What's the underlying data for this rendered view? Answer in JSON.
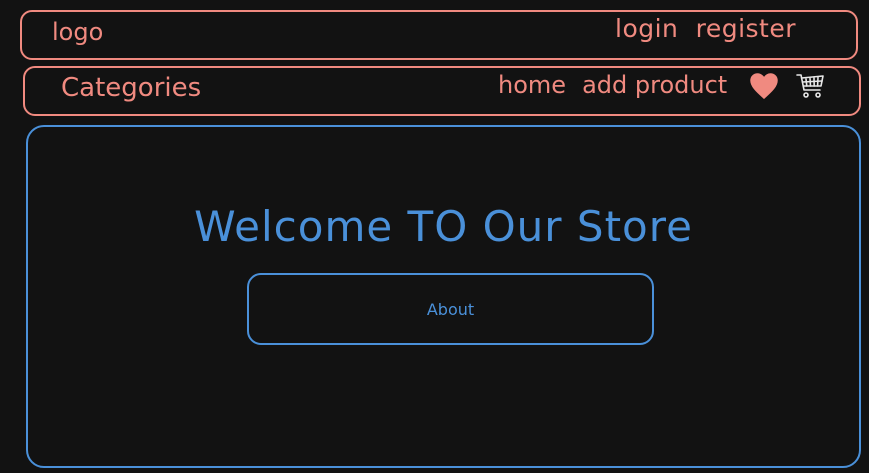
{
  "header": {
    "logo": "logo",
    "login_label": "login",
    "register_label": "register"
  },
  "nav": {
    "categories_label": "Categories",
    "home_label": "home",
    "add_product_label": "add product",
    "favorites_icon": "heart-icon",
    "cart_icon": "cart-icon"
  },
  "hero": {
    "title": "Welcome TO Our Store",
    "about_label": "About"
  },
  "colors": {
    "background": "#121212",
    "accent_salmon": "#f08a80",
    "accent_blue": "#4a90d9"
  }
}
